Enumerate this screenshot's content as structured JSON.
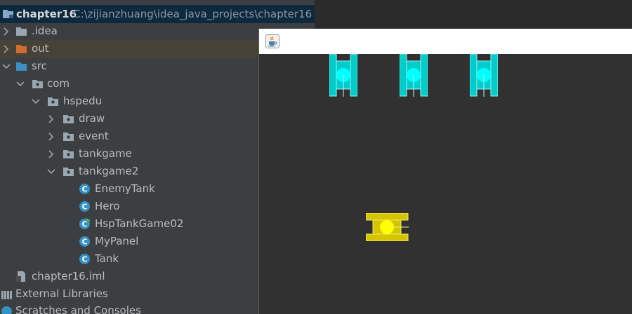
{
  "project": {
    "name": "chapter16",
    "path": "C:\\zijianzhuang\\idea_java_projects\\chapter16"
  },
  "tree": {
    "idea": ".idea",
    "out": "out",
    "src": "src",
    "com": "com",
    "hspedu": "hspedu",
    "draw": "draw",
    "event": "event",
    "tankgame": "tankgame",
    "tankgame2": "tankgame2",
    "classes": [
      "EnemyTank",
      "Hero",
      "HspTankGame02",
      "MyPanel",
      "Tank"
    ],
    "iml": "chapter16.iml",
    "external_libraries": "External Libraries",
    "scratches": "Scratches and Consoles"
  },
  "game": {
    "enemy_count": 3,
    "enemy_color": "#00cccc",
    "enemy_direction": "down",
    "hero_color": "#d4c500",
    "hero_direction": "right"
  },
  "icons": {
    "folder": "folder-icon",
    "package": "package-icon",
    "class": "class-icon",
    "main_class": "runnable-class-icon",
    "module_file": "module-file-icon",
    "libraries": "libraries-icon",
    "scratches": "scratches-icon",
    "window": "java-cup-icon"
  }
}
